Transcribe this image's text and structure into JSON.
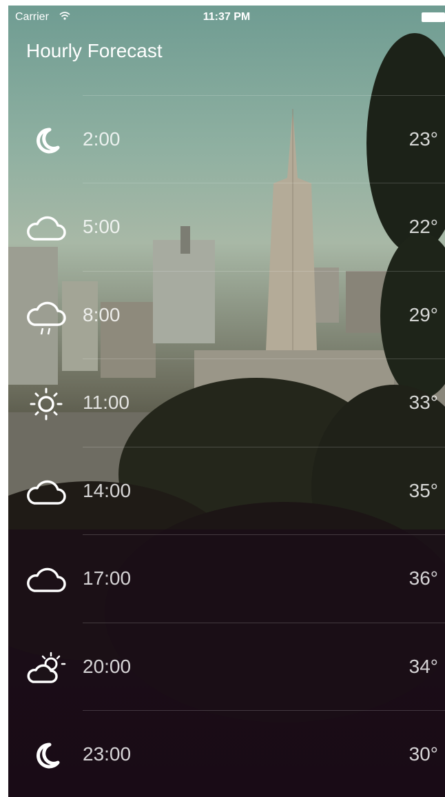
{
  "status_bar": {
    "carrier": "Carrier",
    "time": "11:37 PM"
  },
  "header": {
    "title": "Hourly Forecast"
  },
  "forecast": [
    {
      "time": "2:00",
      "temp": "23°",
      "icon": "moon-icon"
    },
    {
      "time": "5:00",
      "temp": "22°",
      "icon": "cloud-icon"
    },
    {
      "time": "8:00",
      "temp": "29°",
      "icon": "cloud-rain-icon"
    },
    {
      "time": "11:00",
      "temp": "33°",
      "icon": "sun-icon"
    },
    {
      "time": "14:00",
      "temp": "35°",
      "icon": "cloud-icon"
    },
    {
      "time": "17:00",
      "temp": "36°",
      "icon": "cloud-icon"
    },
    {
      "time": "20:00",
      "temp": "34°",
      "icon": "partly-cloudy-icon"
    },
    {
      "time": "23:00",
      "temp": "30°",
      "icon": "moon-icon"
    }
  ]
}
